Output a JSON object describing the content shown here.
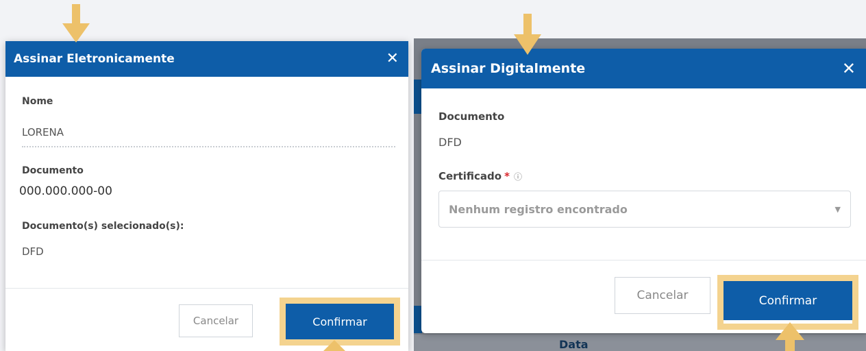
{
  "left_dialog": {
    "title": "Assinar Eletronicamente",
    "close_symbol": "✕",
    "nome_label": "Nome",
    "nome_value": "LORENA",
    "documento_label": "Documento",
    "documento_value": "000.000.000-00",
    "selecionados_label": "Documento(s) selecionado(s):",
    "selecionados_value": "DFD",
    "cancel_label": "Cancelar",
    "confirm_label": "Confirmar"
  },
  "right_dialog": {
    "title": "Assinar Digitalmente",
    "close_symbol": "✕",
    "documento_label": "Documento",
    "documento_value": "DFD",
    "certificado_label": "Certificado",
    "required_marker": "*",
    "info_icon": "ⓘ",
    "certificado_value": "Nenhum registro encontrado",
    "caret": "▼",
    "cancel_label": "Cancelar",
    "confirm_label": "Confirmar"
  },
  "background": {
    "data_column_label": "Data"
  },
  "colors": {
    "header_blue": "#0e5da8",
    "highlight": "#f4d38f",
    "arrow": "#edc16a",
    "required": "#d9262c"
  },
  "icons": {
    "close": "close-icon",
    "info": "info-icon",
    "caret": "chevron-down-icon",
    "annotation_arrow": "arrow-icon"
  }
}
